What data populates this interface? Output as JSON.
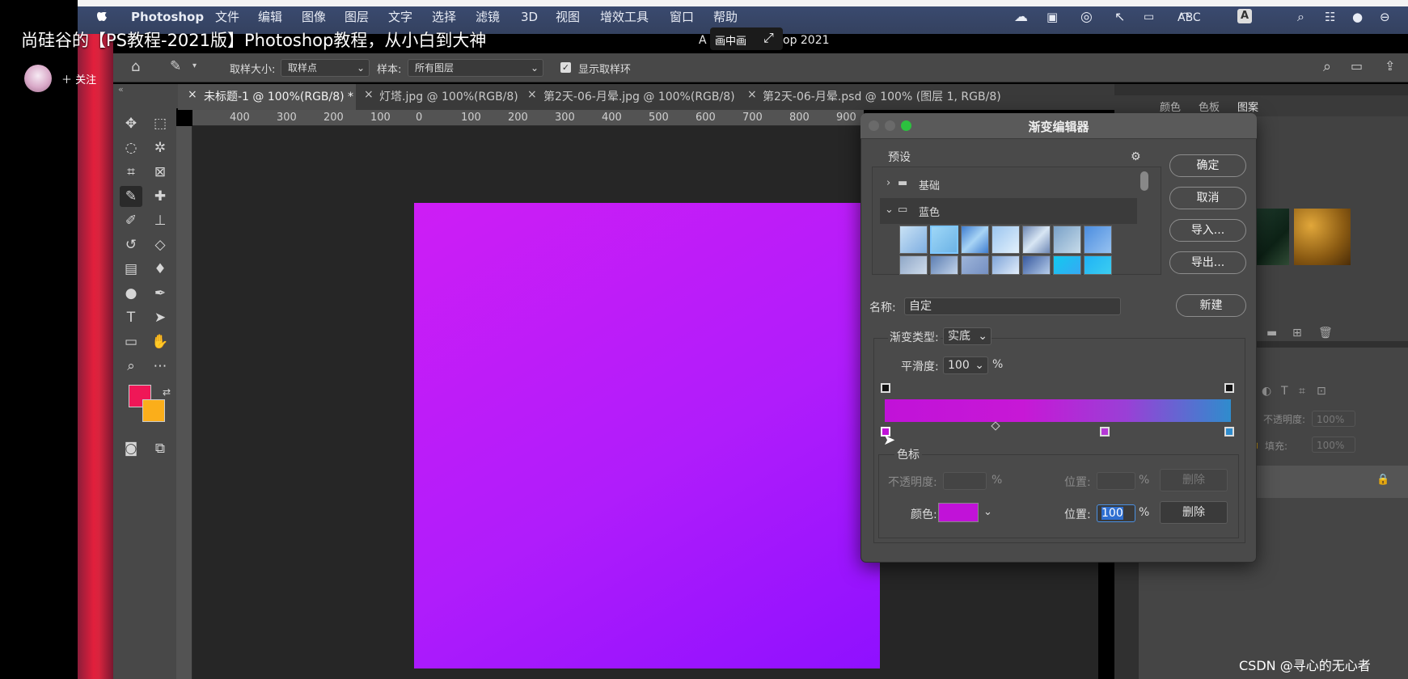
{
  "overlay": {
    "video_title": "尚硅谷的【PS教程-2021版】Photoshop教程，从小白到大神",
    "follow_label": "关注",
    "pip_label": "画中画",
    "window_title_prefix": "A",
    "window_title_suffix": "op 2021",
    "watermark": "CSDN @寻心的无心者"
  },
  "menubar": {
    "app": "Photoshop",
    "items": [
      "文件",
      "编辑",
      "图像",
      "图层",
      "文字",
      "选择",
      "滤镜",
      "3D",
      "视图",
      "增效工具",
      "窗口",
      "帮助"
    ],
    "input_method": "ABC"
  },
  "options_bar": {
    "sample_size_label": "取样大小:",
    "sample_size_value": "取样点",
    "sample_label": "样本:",
    "sample_value": "所有图层",
    "show_ring_label": "显示取样环"
  },
  "tabs": [
    {
      "label": "未标题-1 @ 100%(RGB/8) *"
    },
    {
      "label": "灯塔.jpg @ 100%(RGB/8)"
    },
    {
      "label": "第2天-06-月晕.jpg @ 100%(RGB/8)"
    },
    {
      "label": "第2天-06-月晕.psd @ 100% (图层 1, RGB/8)"
    }
  ],
  "ruler_h_ticks": [
    "400",
    "300",
    "200",
    "100",
    "0",
    "100",
    "200",
    "300",
    "400",
    "500",
    "600",
    "700",
    "800",
    "900"
  ],
  "right_panel": {
    "tabs": [
      "颜色",
      "色板",
      "图案"
    ],
    "opacity_label": "不透明度:",
    "opacity_value": "100%",
    "fill_label": "填充:",
    "fill_value": "100%"
  },
  "colors": {
    "foreground": "#ef1757",
    "background": "#fbae1a",
    "gradient_start": "#c112d8",
    "gradient_end": "#2f8ccd"
  },
  "dialog": {
    "title": "渐变编辑器",
    "presets_label": "预设",
    "folders": [
      {
        "label": "基础",
        "expanded": false
      },
      {
        "label": "蓝色",
        "expanded": true
      }
    ],
    "buttons": {
      "ok": "确定",
      "cancel": "取消",
      "import": "导入...",
      "export": "导出...",
      "new": "新建"
    },
    "name_label": "名称:",
    "name_value": "自定",
    "gradient_type_label": "渐变类型:",
    "gradient_type_value": "实底",
    "smoothness_label": "平滑度:",
    "smoothness_value": "100",
    "percent": "%",
    "color_stops_label": "色标",
    "opacity_label": "不透明度:",
    "location_label": "位置:",
    "delete_label": "删除",
    "color_label": "颜色:",
    "color_location_value": "100"
  }
}
